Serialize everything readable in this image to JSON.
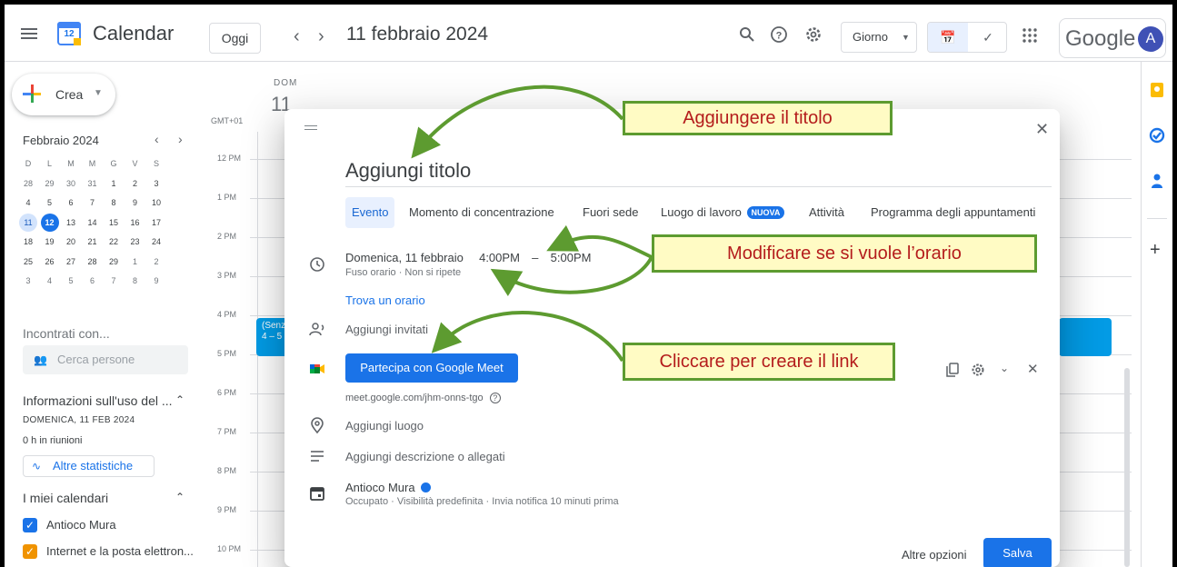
{
  "header": {
    "app_title": "Calendar",
    "logo_day": "12",
    "today_button": "Oggi",
    "prev_icon": "chevron-left-icon",
    "next_icon": "chevron-right-icon",
    "date_title": "11 febbraio 2024",
    "view_select": "Giorno",
    "google_word": "Google",
    "avatar_letter": "A"
  },
  "sidebar": {
    "create_label": "Crea",
    "mini_calendar": {
      "month": "Febbraio 2024",
      "weekdays": [
        "D",
        "L",
        "M",
        "M",
        "G",
        "V",
        "S"
      ],
      "weeks": [
        [
          "28",
          "29",
          "30",
          "31",
          "1",
          "2",
          "3"
        ],
        [
          "4",
          "5",
          "6",
          "7",
          "8",
          "9",
          "10"
        ],
        [
          "11",
          "12",
          "13",
          "14",
          "15",
          "16",
          "17"
        ],
        [
          "18",
          "19",
          "20",
          "21",
          "22",
          "23",
          "24"
        ],
        [
          "25",
          "26",
          "27",
          "28",
          "29",
          "1",
          "2"
        ],
        [
          "3",
          "4",
          "5",
          "6",
          "7",
          "8",
          "9"
        ]
      ],
      "selected_day": "11",
      "today": "12"
    },
    "meet_with_label": "Incontrati con...",
    "search_people_placeholder": "Cerca persone",
    "usage_title": "Informazioni sull'uso del ...",
    "usage_date": "DOMENICA, 11 FEB 2024",
    "usage_hours": "0 h in riunioni",
    "stats_button": "Altre statistiche",
    "my_calendars_label": "I miei calendari",
    "calendars": [
      {
        "name": "Antioco Mura",
        "color": "#1a73e8"
      },
      {
        "name": "Internet e la posta elettron...",
        "color": "#f09300"
      }
    ]
  },
  "main": {
    "day_label": "DOM",
    "day_number": "11",
    "timezone": "GMT+01",
    "hours": [
      "12 PM",
      "1 PM",
      "2 PM",
      "3 PM",
      "4 PM",
      "5 PM",
      "6 PM",
      "7 PM",
      "8 PM",
      "9 PM",
      "10 PM"
    ],
    "event_line1": "(Senz",
    "event_line2": "4 – 5"
  },
  "dialog": {
    "title_placeholder": "Aggiungi titolo",
    "tabs": [
      "Evento",
      "Momento di concentrazione",
      "Fuori sede",
      "Luogo di lavoro",
      "Attività",
      "Programma degli appuntamenti"
    ],
    "new_badge": "NUOVA",
    "date": "Domenica, 11 febbraio",
    "start_time": "4:00PM",
    "dash": "–",
    "end_time": "5:00PM",
    "tz_repeat": "Fuso orario · Non si ripete",
    "find_time": "Trova un orario",
    "add_guests": "Aggiungi invitati",
    "meet_button": "Partecipa con Google Meet",
    "meet_url": "meet.google.com/jhm-onns-tgo",
    "add_location": "Aggiungi luogo",
    "add_description": "Aggiungi descrizione o allegati",
    "calendar_owner": "Antioco Mura",
    "owner_details": "Occupato · Visibilità predefinita · Invia notifica 10 minuti prima",
    "more_options": "Altre opzioni",
    "save_button": "Salva"
  },
  "annotations": {
    "title_callout": "Aggiungere il titolo",
    "time_callout": "Modificare se si vuole l’orario",
    "link_callout": "Cliccare per creare il link",
    "arrow_color": "#5d9b30"
  },
  "colors": {
    "accent": "#1a73e8",
    "event": "#039be5",
    "callout_fill": "#fffbc4",
    "callout_text": "#b41c1c"
  }
}
